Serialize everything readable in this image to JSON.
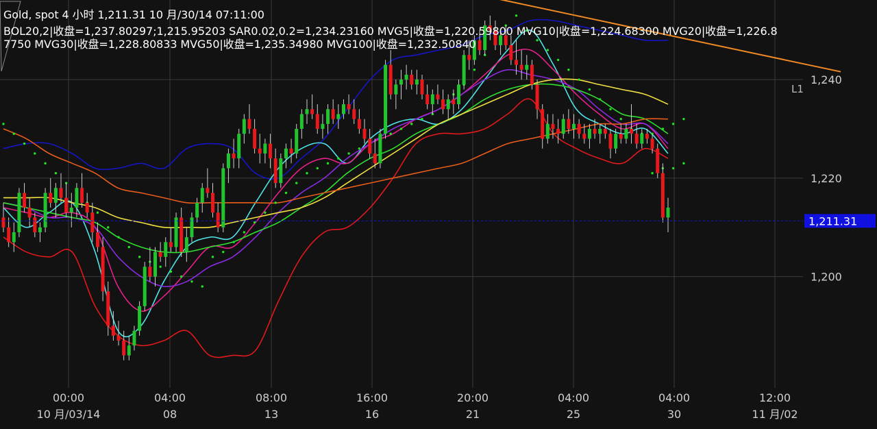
{
  "header": {
    "title": "Gold, spot 4 小时 1,211.31 10 月/30/14 07:11:00",
    "indicators": "BOL20,2|收盘=1,237.80297;1,215.95203 SAR0.02,0.2=1,234.23160 MVG5|收盘=1,220.59800 MVG10|收盘=1,224.68300 MVG20|收盘=1,226.87750 MVG30|收盘=1,228.80833 MVG50|收盘=1,235.34980 MVG100|收盘=1,232.50840"
  },
  "colors": {
    "background": "#121212",
    "grid": "#3a3a3a",
    "up_candle": "#22c32e",
    "down_candle": "#e8191c",
    "bollinger_upper": "#1515c8",
    "bollinger_lower": "#e0191c",
    "sar": "#1fe51f",
    "mvg5": "#4fe3e8",
    "mvg10": "#e8208a",
    "mvg20": "#8a2be2",
    "mvg30": "#30e030",
    "mvg50": "#f0e040",
    "mvg100": "#e85c1a",
    "trendline": "#f08a24",
    "price_tag": "#1010e0"
  },
  "chart_data": {
    "type": "candlestick",
    "symbol": "Gold, spot",
    "timeframe": "4 小时",
    "last_price": 1211.31,
    "last_price_label": "1,211.31",
    "ylim": [
      1183,
      1259
    ],
    "y_ticks": [
      1240,
      1220,
      1200
    ],
    "y_tick_labels": [
      "1,240",
      "1,220",
      "1,200"
    ],
    "x_ticks": [
      {
        "time": "00:00",
        "date": "10 月/03/14"
      },
      {
        "time": "04:00",
        "date": "08"
      },
      {
        "time": "08:00",
        "date": "13"
      },
      {
        "time": "16:00",
        "date": "16"
      },
      {
        "time": "20:00",
        "date": "21"
      },
      {
        "time": "04:00",
        "date": "25"
      },
      {
        "time": "04:00",
        "date": "30"
      },
      {
        "time": "12:00",
        "date": "11 月/02"
      }
    ],
    "trendline_label": "L1",
    "trendline": {
      "from_bar": 74,
      "from_value": 1261,
      "to_bar": 160,
      "to_value": 1241.6
    },
    "candles": [
      [
        1212,
        1215,
        1209,
        1210
      ],
      [
        1210,
        1212,
        1206,
        1207
      ],
      [
        1207,
        1211,
        1205,
        1209
      ],
      [
        1209,
        1218,
        1208,
        1217
      ],
      [
        1217,
        1219,
        1213,
        1214
      ],
      [
        1214,
        1216,
        1210,
        1212
      ],
      [
        1212,
        1213,
        1208,
        1209
      ],
      [
        1209,
        1211,
        1207,
        1210
      ],
      [
        1210,
        1218,
        1209,
        1217
      ],
      [
        1217,
        1220,
        1214,
        1215
      ],
      [
        1215,
        1219,
        1212,
        1218
      ],
      [
        1218,
        1221,
        1215,
        1216
      ],
      [
        1216,
        1219,
        1212,
        1213
      ],
      [
        1213,
        1217,
        1210,
        1214
      ],
      [
        1214,
        1219,
        1212,
        1218
      ],
      [
        1218,
        1221,
        1214,
        1215
      ],
      [
        1215,
        1217,
        1212,
        1213
      ],
      [
        1213,
        1215,
        1207,
        1209
      ],
      [
        1209,
        1211,
        1205,
        1206
      ],
      [
        1206,
        1208,
        1195,
        1197
      ],
      [
        1197,
        1199,
        1188,
        1190
      ],
      [
        1190,
        1193,
        1187,
        1188
      ],
      [
        1188,
        1191,
        1186,
        1187
      ],
      [
        1187,
        1189,
        1183,
        1184
      ],
      [
        1184,
        1188,
        1183,
        1186
      ],
      [
        1186,
        1190,
        1185,
        1189
      ],
      [
        1189,
        1195,
        1188,
        1194
      ],
      [
        1194,
        1203,
        1193,
        1202
      ],
      [
        1202,
        1206,
        1199,
        1200
      ],
      [
        1200,
        1206,
        1198,
        1205
      ],
      [
        1205,
        1207,
        1203,
        1204
      ],
      [
        1204,
        1208,
        1202,
        1207
      ],
      [
        1207,
        1210,
        1205,
        1206
      ],
      [
        1206,
        1213,
        1205,
        1212
      ],
      [
        1212,
        1214,
        1204,
        1205
      ],
      [
        1205,
        1210,
        1203,
        1208
      ],
      [
        1208,
        1213,
        1207,
        1212
      ],
      [
        1212,
        1216,
        1211,
        1215
      ],
      [
        1215,
        1219,
        1213,
        1218
      ],
      [
        1218,
        1222,
        1216,
        1217
      ],
      [
        1217,
        1219,
        1212,
        1213
      ],
      [
        1213,
        1215,
        1209,
        1210
      ],
      [
        1210,
        1223,
        1209,
        1222
      ],
      [
        1222,
        1226,
        1219,
        1225
      ],
      [
        1225,
        1228,
        1222,
        1224
      ],
      [
        1224,
        1230,
        1222,
        1229
      ],
      [
        1229,
        1233,
        1227,
        1232
      ],
      [
        1232,
        1235,
        1229,
        1230
      ],
      [
        1230,
        1232,
        1225,
        1226
      ],
      [
        1226,
        1229,
        1223,
        1225
      ],
      [
        1225,
        1228,
        1223,
        1227
      ],
      [
        1227,
        1229,
        1222,
        1224
      ],
      [
        1224,
        1226,
        1218,
        1219
      ],
      [
        1219,
        1225,
        1218,
        1224
      ],
      [
        1224,
        1227,
        1222,
        1226
      ],
      [
        1226,
        1228,
        1223,
        1225
      ],
      [
        1225,
        1231,
        1224,
        1230
      ],
      [
        1230,
        1234,
        1228,
        1233
      ],
      [
        1233,
        1236,
        1231,
        1234
      ],
      [
        1234,
        1237,
        1232,
        1233
      ],
      [
        1233,
        1235,
        1229,
        1230
      ],
      [
        1230,
        1233,
        1228,
        1231
      ],
      [
        1231,
        1235,
        1229,
        1234
      ],
      [
        1234,
        1236,
        1231,
        1232
      ],
      [
        1232,
        1235,
        1230,
        1233
      ],
      [
        1233,
        1236,
        1232,
        1235
      ],
      [
        1235,
        1237,
        1233,
        1234
      ],
      [
        1234,
        1236,
        1231,
        1232
      ],
      [
        1232,
        1234,
        1229,
        1230
      ],
      [
        1230,
        1232,
        1227,
        1228
      ],
      [
        1228,
        1230,
        1224,
        1225
      ],
      [
        1225,
        1228,
        1222,
        1223
      ],
      [
        1223,
        1230,
        1222,
        1229
      ],
      [
        1229,
        1244,
        1228,
        1243
      ],
      [
        1243,
        1246,
        1236,
        1237
      ],
      [
        1237,
        1240,
        1234,
        1239
      ],
      [
        1239,
        1242,
        1236,
        1240
      ],
      [
        1240,
        1243,
        1238,
        1241
      ],
      [
        1241,
        1242,
        1238,
        1239
      ],
      [
        1239,
        1242,
        1237,
        1240
      ],
      [
        1240,
        1241,
        1236,
        1237
      ],
      [
        1237,
        1239,
        1234,
        1235
      ],
      [
        1235,
        1238,
        1233,
        1237
      ],
      [
        1237,
        1239,
        1235,
        1236
      ],
      [
        1236,
        1238,
        1233,
        1234
      ],
      [
        1234,
        1237,
        1232,
        1236
      ],
      [
        1236,
        1238,
        1233,
        1235
      ],
      [
        1235,
        1240,
        1234,
        1239
      ],
      [
        1239,
        1246,
        1238,
        1245
      ],
      [
        1245,
        1248,
        1242,
        1244
      ],
      [
        1244,
        1249,
        1243,
        1248
      ],
      [
        1248,
        1250,
        1245,
        1246
      ],
      [
        1246,
        1252,
        1245,
        1251
      ],
      [
        1251,
        1253,
        1248,
        1250
      ],
      [
        1250,
        1252,
        1246,
        1247
      ],
      [
        1247,
        1250,
        1245,
        1249
      ],
      [
        1249,
        1251,
        1246,
        1247
      ],
      [
        1247,
        1249,
        1243,
        1244
      ],
      [
        1244,
        1248,
        1241,
        1243
      ],
      [
        1243,
        1246,
        1240,
        1242
      ],
      [
        1242,
        1245,
        1240,
        1243
      ],
      [
        1243,
        1244,
        1238,
        1239
      ],
      [
        1239,
        1240,
        1232,
        1234
      ],
      [
        1234,
        1235,
        1226,
        1228
      ],
      [
        1228,
        1233,
        1227,
        1231
      ],
      [
        1231,
        1233,
        1228,
        1230
      ],
      [
        1230,
        1232,
        1227,
        1229
      ],
      [
        1229,
        1233,
        1228,
        1232
      ],
      [
        1232,
        1234,
        1229,
        1230
      ],
      [
        1230,
        1233,
        1228,
        1231
      ],
      [
        1231,
        1232,
        1228,
        1229
      ],
      [
        1229,
        1231,
        1227,
        1228
      ],
      [
        1228,
        1231,
        1226,
        1230
      ],
      [
        1230,
        1232,
        1228,
        1229
      ],
      [
        1229,
        1231,
        1227,
        1230
      ],
      [
        1230,
        1231,
        1228,
        1229
      ],
      [
        1229,
        1230,
        1224,
        1226
      ],
      [
        1226,
        1230,
        1225,
        1229
      ],
      [
        1229,
        1231,
        1227,
        1228
      ],
      [
        1228,
        1231,
        1227,
        1230
      ],
      [
        1230,
        1235,
        1227,
        1229
      ],
      [
        1229,
        1231,
        1226,
        1227
      ],
      [
        1227,
        1230,
        1226,
        1229
      ],
      [
        1229,
        1230,
        1227,
        1228
      ],
      [
        1228,
        1229,
        1225,
        1226
      ],
      [
        1226,
        1227,
        1220,
        1221
      ],
      [
        1221,
        1223,
        1211,
        1212
      ],
      [
        1212,
        1216,
        1209,
        1214
      ]
    ],
    "series": [
      {
        "name": "BOL20,2 upper",
        "values": [
          1226,
          1227,
          1227,
          1225,
          1222,
          1222,
          1223,
          1222,
          1226,
          1227,
          1226,
          1221,
          1220,
          1224,
          1228,
          1234,
          1240,
          1244,
          1245,
          1246,
          1247,
          1249,
          1250,
          1252,
          1252,
          1251,
          1250,
          1249,
          1248,
          1248
        ]
      },
      {
        "name": "BOL20,2 lower",
        "values": [
          1208,
          1205,
          1204,
          1205,
          1194,
          1188,
          1186,
          1187,
          1189,
          1184,
          1184,
          1185,
          1195,
          1204,
          1209,
          1210,
          1214,
          1220,
          1227,
          1229,
          1229,
          1230,
          1233,
          1236,
          1229,
          1226,
          1224,
          1223,
          1226,
          1224
        ]
      },
      {
        "name": "MVG5",
        "values": [
          1214,
          1210,
          1213,
          1215,
          1205,
          1189,
          1190,
          1199,
          1206,
          1208,
          1208,
          1215,
          1222,
          1226,
          1227,
          1223,
          1228,
          1231,
          1232,
          1231,
          1234,
          1240,
          1246,
          1250,
          1243,
          1234,
          1231,
          1229,
          1230,
          1225
        ]
      },
      {
        "name": "MVG10",
        "values": [
          1214,
          1213,
          1212,
          1213,
          1210,
          1198,
          1193,
          1196,
          1201,
          1206,
          1206,
          1211,
          1217,
          1222,
          1224,
          1223,
          1227,
          1229,
          1232,
          1234,
          1237,
          1241,
          1245,
          1246,
          1242,
          1237,
          1233,
          1230,
          1231,
          1226
        ]
      },
      {
        "name": "MVG20",
        "values": [
          1215,
          1214,
          1212,
          1212,
          1210,
          1204,
          1200,
          1198,
          1199,
          1202,
          1204,
          1208,
          1213,
          1217,
          1220,
          1224,
          1227,
          1230,
          1232,
          1234,
          1237,
          1240,
          1242,
          1241,
          1240,
          1238,
          1234,
          1231,
          1231,
          1227
        ]
      },
      {
        "name": "MVG30",
        "values": [
          1215,
          1214,
          1213,
          1212,
          1211,
          1208,
          1206,
          1205,
          1205,
          1206,
          1207,
          1209,
          1211,
          1214,
          1217,
          1221,
          1224,
          1226,
          1229,
          1231,
          1233,
          1236,
          1238,
          1239,
          1239,
          1238,
          1236,
          1233,
          1232,
          1229
        ]
      },
      {
        "name": "MVG50",
        "values": [
          1216,
          1216,
          1216,
          1215,
          1214,
          1212,
          1211,
          1210,
          1210,
          1210,
          1211,
          1212,
          1213,
          1214,
          1216,
          1219,
          1222,
          1225,
          1228,
          1231,
          1233,
          1235,
          1237,
          1239,
          1240,
          1240,
          1239,
          1238,
          1237,
          1235
        ]
      },
      {
        "name": "MVG100",
        "values": [
          1230,
          1228,
          1225,
          1223,
          1221,
          1218,
          1217,
          1216,
          1215,
          1215,
          1215,
          1215,
          1215,
          1216,
          1217,
          1218,
          1219,
          1220,
          1221,
          1222,
          1223,
          1225,
          1227,
          1228,
          1229,
          1230,
          1231,
          1231,
          1232,
          1232
        ]
      }
    ],
    "sar": [
      [
        0,
        1231
      ],
      [
        2,
        1229
      ],
      [
        4,
        1227
      ],
      [
        6,
        1225
      ],
      [
        8,
        1223
      ],
      [
        10,
        1221
      ],
      [
        12,
        1219
      ],
      [
        14,
        1217
      ],
      [
        16,
        1215
      ],
      [
        18,
        1213
      ],
      [
        20,
        1210
      ],
      [
        22,
        1208
      ],
      [
        24,
        1206
      ],
      [
        26,
        1204
      ],
      [
        28,
        1203
      ],
      [
        30,
        1202
      ],
      [
        32,
        1201
      ],
      [
        34,
        1200
      ],
      [
        36,
        1199
      ],
      [
        38,
        1198
      ],
      [
        40,
        1204
      ],
      [
        42,
        1205
      ],
      [
        44,
        1207
      ],
      [
        46,
        1209
      ],
      [
        48,
        1211
      ],
      [
        50,
        1213
      ],
      [
        52,
        1215
      ],
      [
        54,
        1217
      ],
      [
        56,
        1219
      ],
      [
        58,
        1221
      ],
      [
        60,
        1222
      ],
      [
        62,
        1223
      ],
      [
        64,
        1224
      ],
      [
        66,
        1225
      ],
      [
        68,
        1226
      ],
      [
        70,
        1227
      ],
      [
        72,
        1228
      ],
      [
        74,
        1229
      ],
      [
        76,
        1230
      ],
      [
        78,
        1231
      ],
      [
        80,
        1232
      ],
      [
        82,
        1233
      ],
      [
        84,
        1235
      ],
      [
        86,
        1237
      ],
      [
        88,
        1239
      ],
      [
        90,
        1242
      ],
      [
        92,
        1245
      ],
      [
        94,
        1248
      ],
      [
        96,
        1251
      ],
      [
        98,
        1253
      ],
      [
        100,
        1250
      ],
      [
        102,
        1248
      ],
      [
        104,
        1246
      ],
      [
        106,
        1244
      ],
      [
        108,
        1242
      ],
      [
        110,
        1240
      ],
      [
        112,
        1238
      ],
      [
        114,
        1236
      ],
      [
        116,
        1234
      ],
      [
        118,
        1232
      ],
      [
        120,
        1230
      ],
      [
        122,
        1229
      ],
      [
        124,
        1229
      ],
      [
        126,
        1230
      ],
      [
        128,
        1231
      ],
      [
        130,
        1232
      ],
      [
        124,
        1221
      ],
      [
        126,
        1222
      ],
      [
        128,
        1222
      ],
      [
        130,
        1223
      ]
    ]
  }
}
